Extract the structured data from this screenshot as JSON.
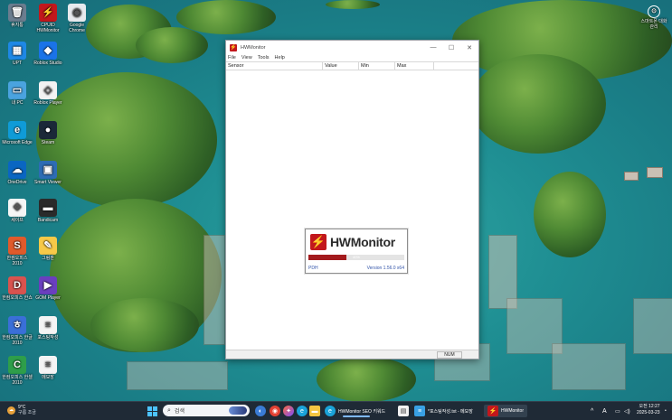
{
  "desktop": {
    "icons": [
      {
        "label": "휴지통",
        "icon": "recycle-bin-icon",
        "color": "#6b7d8f",
        "glyph": "🗑"
      },
      {
        "label": "CPUID HWMonitor",
        "icon": "hwmonitor-icon",
        "color": "#c2171c",
        "glyph": "⚡"
      },
      {
        "label": "Google Chrome",
        "icon": "chrome-icon",
        "color": "#e8eaed",
        "glyph": "◉"
      },
      {
        "label": "UPT",
        "icon": "upt-icon",
        "color": "#1e88e5",
        "glyph": "▦"
      },
      {
        "label": "Roblox Studio",
        "icon": "roblox-studio-icon",
        "color": "#1a73e8",
        "glyph": "◆"
      },
      {
        "label": "내 PC",
        "icon": "this-pc-icon",
        "color": "#4aa3df",
        "glyph": "▭"
      },
      {
        "label": "Roblox Player",
        "icon": "roblox-player-icon",
        "color": "#f2f2f2",
        "glyph": "◇"
      },
      {
        "label": "Microsoft Edge",
        "icon": "edge-icon",
        "color": "#0f9bd7",
        "glyph": "e"
      },
      {
        "label": "Steam",
        "icon": "steam-icon",
        "color": "#1b2838",
        "glyph": "●"
      },
      {
        "label": "OneDrive",
        "icon": "onedrive-icon",
        "color": "#0a66c2",
        "glyph": "☁"
      },
      {
        "label": "Smart Viewer",
        "icon": "smart-viewer-icon",
        "color": "#2d6cb4",
        "glyph": "▣"
      },
      {
        "label": "세이프",
        "icon": "safe-icon",
        "color": "#f5f5f5",
        "glyph": "❖"
      },
      {
        "label": "Bandicam",
        "icon": "bandicam-icon",
        "color": "#2a2a2a",
        "glyph": "▬"
      },
      {
        "label": "한컴오피스 2010",
        "icon": "hancom-show-icon",
        "color": "#e05a2b",
        "glyph": "S"
      },
      {
        "label": "그림판",
        "icon": "paint-icon",
        "color": "#f7c948",
        "glyph": "✎"
      },
      {
        "label": "한컴오피스 한쇼",
        "icon": "hancom-slide-icon",
        "color": "#d9534f",
        "glyph": "D"
      },
      {
        "label": "GOM Player",
        "icon": "gom-icon",
        "color": "#6a3fbf",
        "glyph": "▶"
      },
      {
        "label": "한컴오피스 한글 2010",
        "icon": "hancom-hwp-icon",
        "color": "#3a6fd8",
        "glyph": "ㅎ"
      },
      {
        "label": "포스팅작성",
        "icon": "text-file-icon",
        "color": "#f4f4f4",
        "glyph": "≡"
      },
      {
        "label": "한컴오피스 한셀 2010",
        "icon": "hancom-cell-icon",
        "color": "#2e9e4a",
        "glyph": "C"
      },
      {
        "label": "메모장",
        "icon": "text-file-icon",
        "color": "#f4f4f4",
        "glyph": "≡"
      }
    ],
    "overlay_icon_label": "스마트폰 대화 관리"
  },
  "window": {
    "title": "HWMonitor",
    "menu": [
      "File",
      "View",
      "Tools",
      "Help"
    ],
    "columns": [
      "Sensor",
      "Value",
      "Min",
      "Max"
    ],
    "status_num": "NUM",
    "splash": {
      "product": "HWMonitor",
      "progress_percent": 40,
      "progress_label": "40%",
      "left_text": "PDH",
      "version_text": "Version 1.56.0 x64"
    }
  },
  "taskbar": {
    "weather_temp": "9°C",
    "weather_desc": "구름 조금",
    "search_placeholder": "검색",
    "apps": [
      {
        "label": "HWMonitor SEO 키워드",
        "icon": "edge-icon"
      },
      {
        "label": "*포스팅작성.txt - 메모장",
        "icon": "notepad-icon"
      },
      {
        "label": "HWMonitor",
        "icon": "hwmonitor-icon"
      }
    ],
    "ime_lang": "A",
    "time": "오전 12:27",
    "date": "2025-03-23"
  }
}
